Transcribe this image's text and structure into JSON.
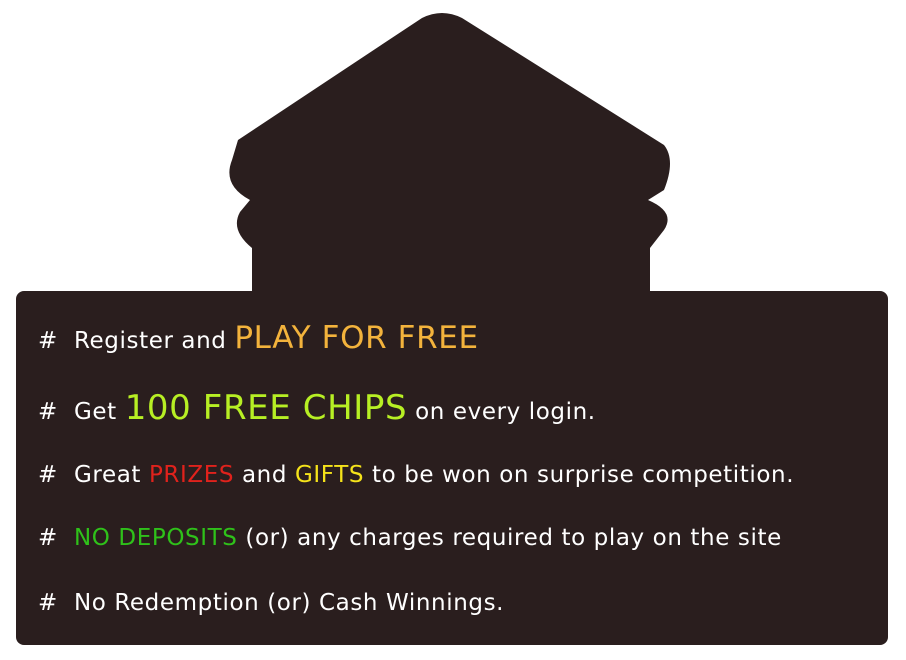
{
  "colors": {
    "panel": "#2a1e1e",
    "text": "#ffffff",
    "orange": "#f3b33c",
    "lime": "#b7ef24",
    "red": "#e0221c",
    "yellow": "#f5e31a",
    "green": "#2fc11a"
  },
  "bullet": "#",
  "lines": [
    {
      "segments": [
        {
          "text": "Register and "
        },
        {
          "text": "PLAY FOR FREE"
        }
      ]
    },
    {
      "segments": [
        {
          "text": "Get "
        },
        {
          "text": "100 FREE CHIPS"
        },
        {
          "text": " on every login."
        }
      ]
    },
    {
      "segments": [
        {
          "text": "Great "
        },
        {
          "text": "PRIZES"
        },
        {
          "text": " and "
        },
        {
          "text": "GIFTS"
        },
        {
          "text": " to be won on surprise competition."
        }
      ]
    },
    {
      "segments": [
        {
          "text": "NO DEPOSITS"
        },
        {
          "text": " (or) any charges required to play on the site"
        }
      ]
    },
    {
      "segments": [
        {
          "text": "No Redemption (or) Cash Winnings."
        }
      ]
    }
  ]
}
